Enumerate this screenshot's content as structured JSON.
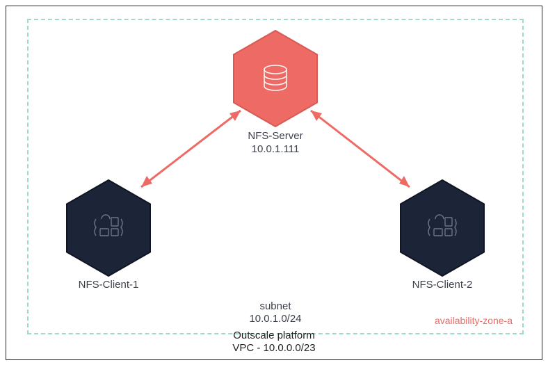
{
  "diagram": {
    "platform_line1": "Outscale platform",
    "platform_line2": "VPC - 10.0.0.0/23",
    "subnet_line1": "subnet",
    "subnet_line2": "10.0.1.0/24",
    "availability_zone": "availability-zone-a",
    "nodes": {
      "server": {
        "label": "NFS-Server",
        "ip": "10.0.1.111"
      },
      "client1": {
        "label": "NFS-Client-1"
      },
      "client2": {
        "label": "NFS-Client-2"
      }
    },
    "colors": {
      "accent": "#ed6a65",
      "dark": "#1c2538",
      "subnet_border": "#9fdac7"
    }
  }
}
